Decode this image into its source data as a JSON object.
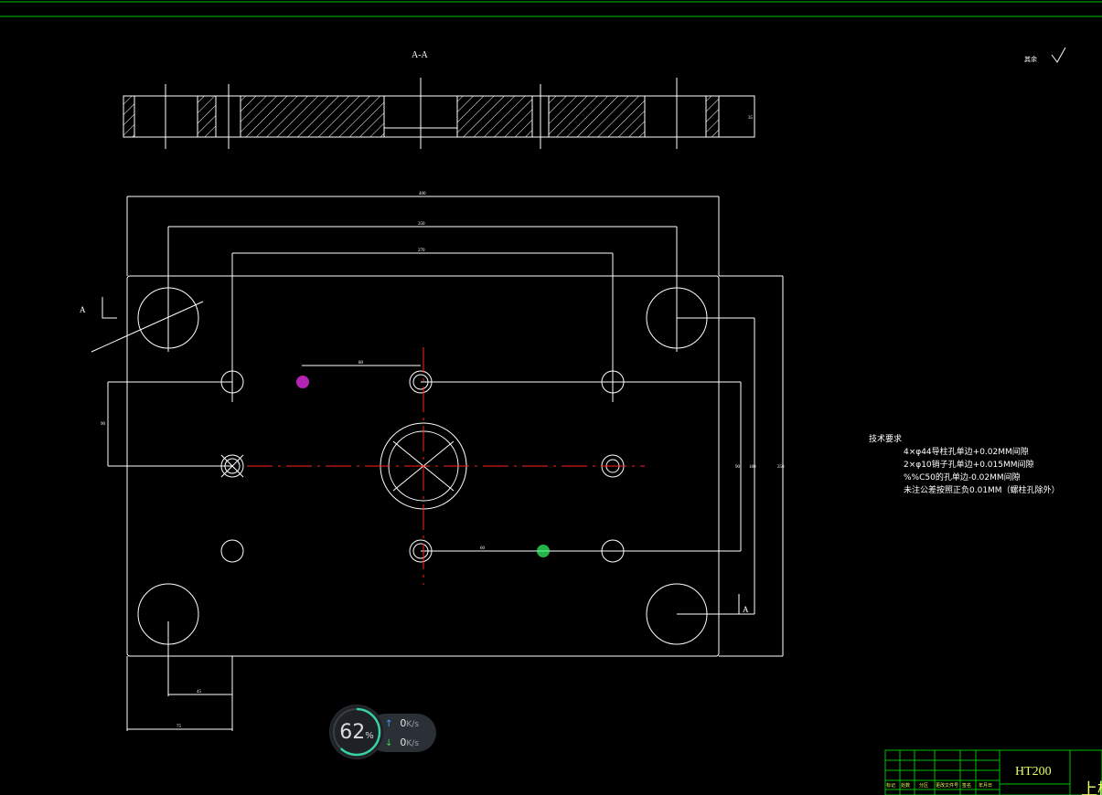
{
  "drawing": {
    "section_label": "A-A",
    "view_marker": "A",
    "roughness_note": "其余",
    "tech_requirements": {
      "title": "技术要求",
      "items": [
        "4×φ44导柱孔单边+0.02MM间隙",
        "2×φ10销子孔单边+0.015MM间隙",
        "%%C50的孔单边-0.02MM间隙",
        "未注公差按照正负0.01MM（螺柱孔除外）"
      ]
    },
    "dimensions": {
      "overall_width": "400",
      "guide_span": "350",
      "inner_span": "270",
      "small_h": "75",
      "small_h2": "45",
      "small_top": "80",
      "left_v": "90",
      "right_v1": "90",
      "right_v2": "180",
      "right_v3": "250",
      "mid_h": "60",
      "thickness": "35"
    },
    "title_block": {
      "material": "HT200",
      "part_name": "上模",
      "headers": [
        "标记",
        "处数",
        "分区",
        "更改文件号",
        "签名",
        "年月日"
      ]
    }
  },
  "netmon": {
    "percent": "62",
    "percent_unit": "%",
    "upload": "0",
    "download": "0",
    "rate_unit": "K/s",
    "gauge_fraction": 0.62
  }
}
